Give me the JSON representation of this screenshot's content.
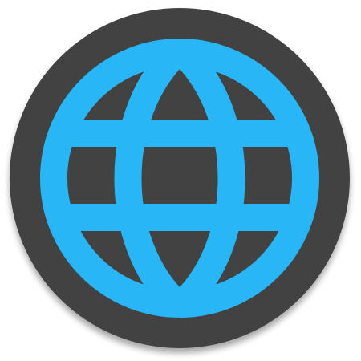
{
  "icon": {
    "name": "globe-icon",
    "colors": {
      "background_disc": "#424242",
      "globe_stroke": "#29b6f6",
      "page_background": "#ffffff"
    }
  }
}
